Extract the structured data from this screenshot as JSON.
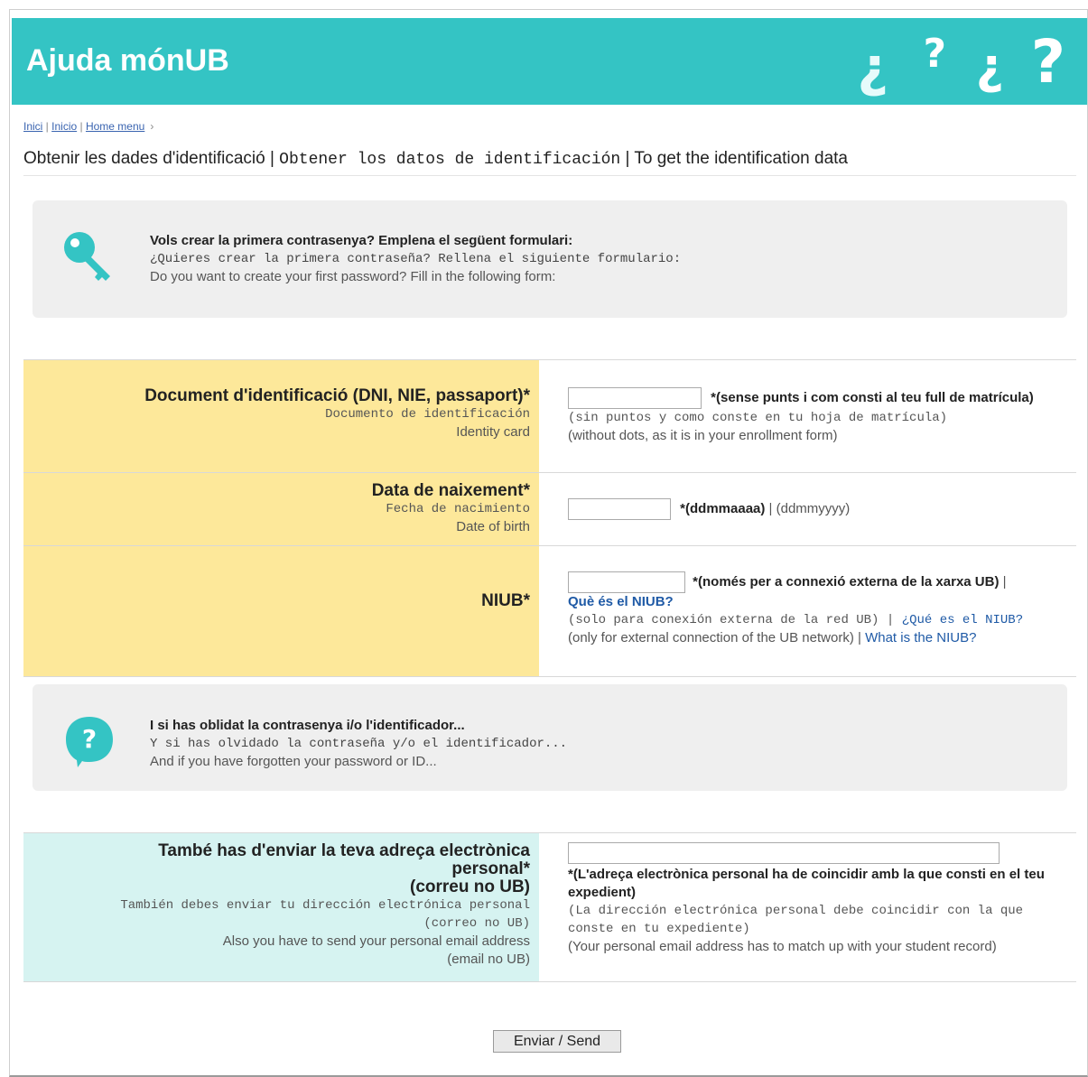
{
  "header": {
    "title": "Ajuda mónUB",
    "qmarks": [
      "¿",
      "?",
      "¿",
      "?"
    ]
  },
  "breadcrumb": {
    "inici": "Inici",
    "inicio": "Inicio",
    "home": "Home menu",
    "arrow": "›"
  },
  "page_title": {
    "ca": "Obtenir les dades d'identificació",
    "es": "Obtener los datos de identificación",
    "en": "To get the identification data",
    "sep": "|"
  },
  "intro": {
    "ca": "Vols crear la primera contrasenya? Emplena el següent formulari:",
    "es": "¿Quieres crear la primera contraseña? Rellena el siguiente formulario:",
    "en": "Do you want to create your first password? Fill in the following form:"
  },
  "fields": {
    "document": {
      "label_ca": "Document d'identificació (DNI, NIE, passaport)*",
      "label_es": "Documento de identificación",
      "label_en": "Identity card",
      "value": "",
      "hint_ca": "*(sense punts i com consti al teu full de matrícula)",
      "hint_es": "(sin puntos y como conste en tu hoja de matrícula)",
      "hint_en": "(without dots, as it is in your enrollment form)"
    },
    "birth": {
      "label_ca": "Data de naixement*",
      "label_es": "Fecha de nacimiento",
      "label_en": "Date of birth",
      "value": "",
      "hint_ca": "*(ddmmaaaa)",
      "hint_sep": "|",
      "hint_en": "(ddmmyyyy)"
    },
    "niub": {
      "label_ca": "NIUB*",
      "value": "",
      "hint_ca": "*(només per a connexió externa de la xarxa UB)",
      "link_ca": "Què és el NIUB?",
      "hint_es": "(solo para conexión externa de la red UB)",
      "link_es": "¿Qué es el NIUB?",
      "hint_en": "(only for external connection of the UB network)",
      "link_en": "What is the NIUB?",
      "sep": "|"
    },
    "email": {
      "label_ca_1": "També has d'enviar la teva adreça electrònica personal*",
      "label_ca_2": "(correu no UB)",
      "label_es_1": "También debes enviar tu dirección electrónica personal",
      "label_es_2": "(correo no UB)",
      "label_en_1": "Also you have to send your personal email address",
      "label_en_2": "(email no UB)",
      "value": "",
      "hint_ca": "*(L'adreça electrònica personal ha de coincidir amb la que consti en el teu expedient)",
      "hint_es": "(La dirección electrónica personal debe coincidir con la que conste en tu expediente)",
      "hint_en": "(Your personal email address has to match up with your student record)"
    }
  },
  "forgot": {
    "ca": "I si has oblidat la contrasenya i/o l'identificador...",
    "es": "Y si has olvidado la contraseña y/o el identificador...",
    "en": "And if you have forgotten your password or ID..."
  },
  "submit_label": "Enviar / Send",
  "colors": {
    "header": "#34c4c4",
    "yellow": "#fde89a",
    "cyan": "#d6f3f1",
    "link": "#1f5aa6"
  },
  "icons": {
    "key": "key-icon",
    "help": "help-bubble-icon"
  }
}
